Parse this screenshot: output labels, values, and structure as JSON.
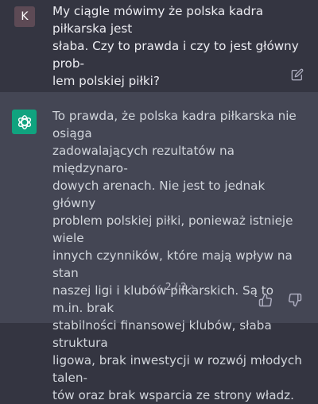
{
  "user_message": {
    "avatar_initial": "K",
    "avatar_color": "#5d4a55",
    "text": "My ciągle mówimy że polska kadra piłkarska jest\nsłaba. Czy to prawda i czy to jest główny prob-\nlem polskiej piłki?",
    "edit_icon": "edit-icon"
  },
  "assistant_message": {
    "avatar_color": "#10a37f",
    "avatar_icon": "openai-logo-icon",
    "text": "To prawda, że polska kadra piłkarska nie osiąga\nzadowalających rezultatów na międzynaro-\ndowych arenach. Nie jest to jednak główny\nproblem polskiej piłki, ponieważ istnieje wiele\ninnych czynników, które mają wpływ na stan\nnaszej ligi i klubów piłkarskich. Są to m.in. brak\nstabilności finansowej klubów, słaba struktura\nligowa, brak inwestycji w rozwój młodych talen-\ntów oraz brak wsparcia ze strony władz.",
    "pager": {
      "prev": "‹",
      "label": "2 / 2",
      "next": "›"
    },
    "feedback": {
      "thumbs_up_icon": "thumbs-up-icon",
      "thumbs_down_icon": "thumbs-down-icon"
    }
  },
  "colors": {
    "user_bg": "#343541",
    "assistant_bg": "#444654",
    "text": "#ececf1"
  }
}
